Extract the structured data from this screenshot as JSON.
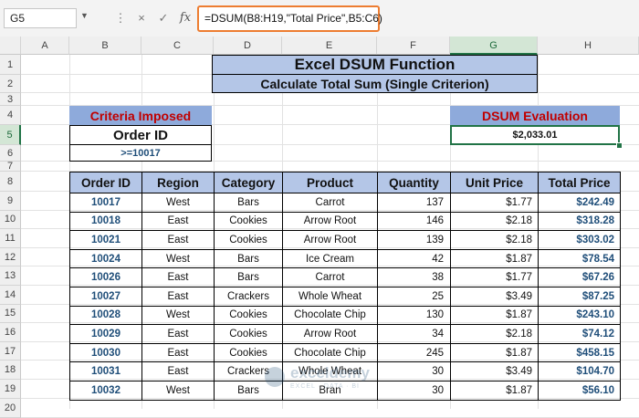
{
  "formula_bar": {
    "name_box": "G5",
    "formula": "=DSUM(B8:H19,\"Total Price\",B5:C6)",
    "fx_label": "fx",
    "cancel_icon": "×",
    "enter_icon": "✓"
  },
  "columns": [
    "A",
    "B",
    "C",
    "D",
    "E",
    "F",
    "G",
    "H"
  ],
  "rows": [
    "1",
    "2",
    "3",
    "4",
    "5",
    "6",
    "7",
    "8",
    "9",
    "10",
    "11",
    "12",
    "13",
    "14",
    "15",
    "16",
    "17",
    "18",
    "19",
    "20"
  ],
  "selected_cell": {
    "column": "G",
    "row": "5"
  },
  "title": {
    "main": "Excel DSUM Function",
    "sub": "Calculate Total Sum (Single Criterion)"
  },
  "criteria": {
    "header": "Criteria Imposed",
    "label": "Order ID",
    "value": ">=10017"
  },
  "evaluation": {
    "header": "DSUM Evaluation",
    "value": "$2,033.01"
  },
  "table": {
    "headers": [
      "Order ID",
      "Region",
      "Category",
      "Product",
      "Quantity",
      "Unit Price",
      "Total Price"
    ],
    "rows": [
      [
        "10017",
        "West",
        "Bars",
        "Carrot",
        "137",
        "$1.77",
        "$242.49"
      ],
      [
        "10018",
        "East",
        "Cookies",
        "Arrow Root",
        "146",
        "$2.18",
        "$318.28"
      ],
      [
        "10021",
        "East",
        "Cookies",
        "Arrow Root",
        "139",
        "$2.18",
        "$303.02"
      ],
      [
        "10024",
        "West",
        "Bars",
        "Ice Cream",
        "42",
        "$1.87",
        "$78.54"
      ],
      [
        "10026",
        "East",
        "Bars",
        "Carrot",
        "38",
        "$1.77",
        "$67.26"
      ],
      [
        "10027",
        "East",
        "Crackers",
        "Whole Wheat",
        "25",
        "$3.49",
        "$87.25"
      ],
      [
        "10028",
        "West",
        "Cookies",
        "Chocolate Chip",
        "130",
        "$1.87",
        "$243.10"
      ],
      [
        "10029",
        "East",
        "Cookies",
        "Arrow Root",
        "34",
        "$2.18",
        "$74.12"
      ],
      [
        "10030",
        "East",
        "Cookies",
        "Chocolate Chip",
        "245",
        "$1.87",
        "$458.15"
      ],
      [
        "10031",
        "East",
        "Crackers",
        "Whole Wheat",
        "30",
        "$3.49",
        "$104.70"
      ],
      [
        "10032",
        "West",
        "Bars",
        "Bran",
        "30",
        "$1.87",
        "$56.10"
      ]
    ]
  },
  "watermark": {
    "name": "exceldemy",
    "tagline": "EXCEL · DATA · BI"
  }
}
